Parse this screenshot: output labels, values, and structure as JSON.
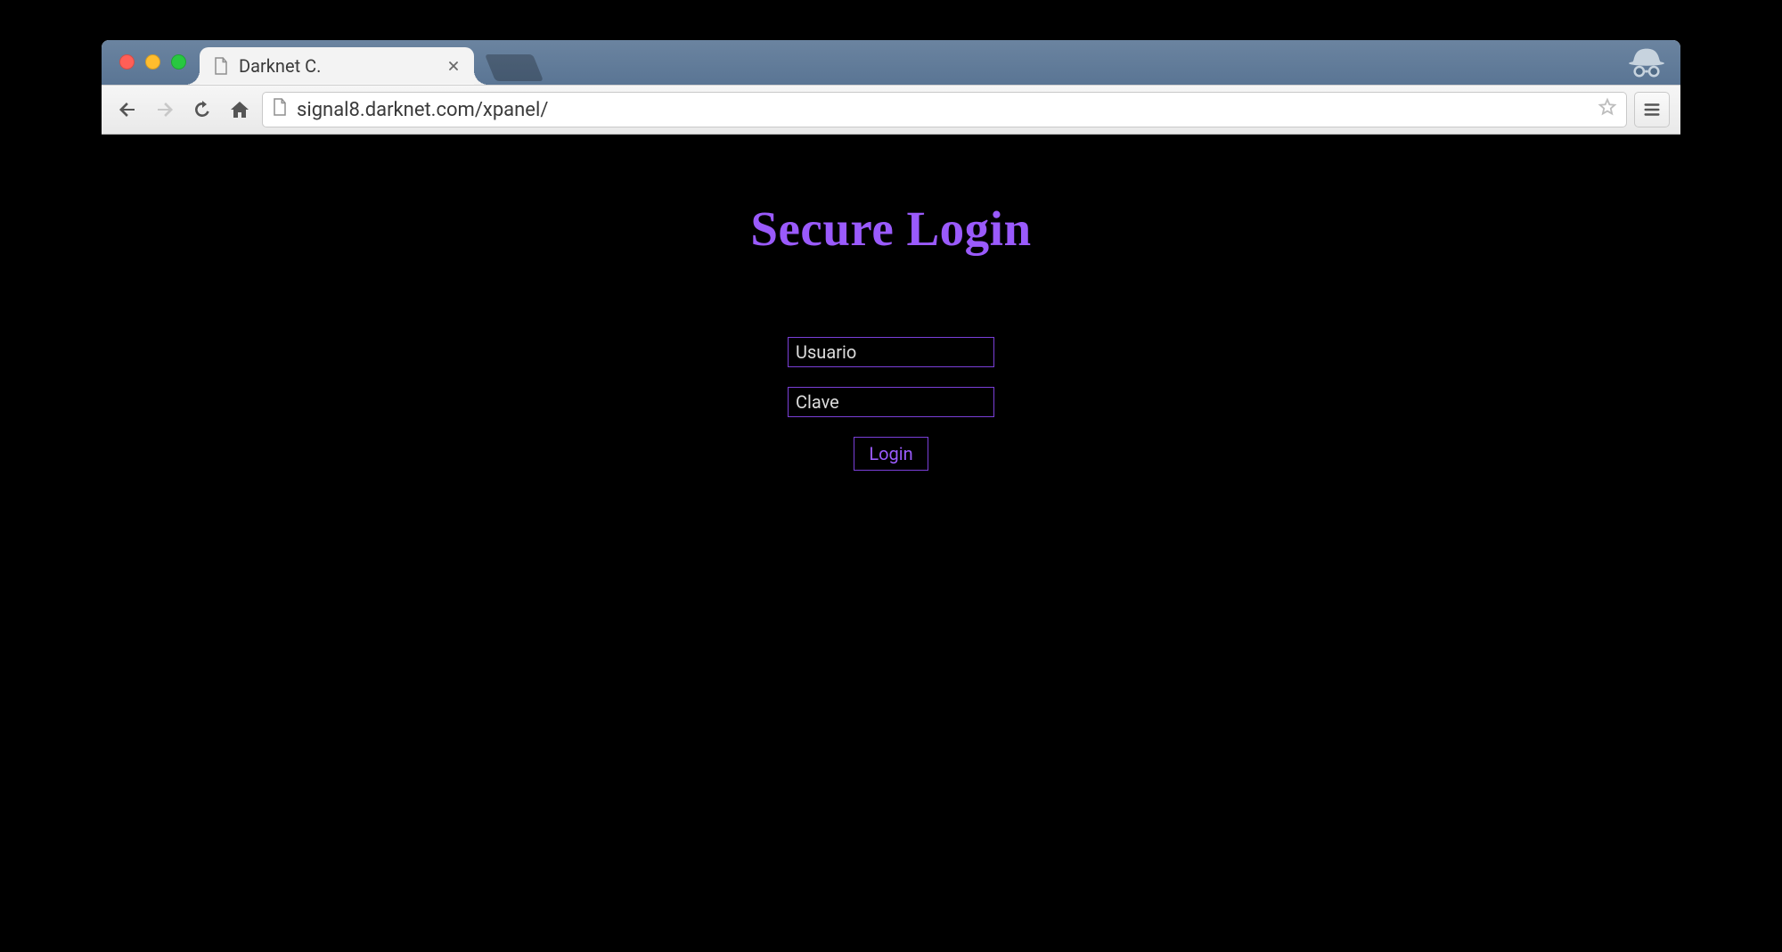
{
  "browser": {
    "tab_title": "Darknet C.",
    "url": "signal8.darknet.com/xpanel/"
  },
  "page": {
    "heading": "Secure Login",
    "username_placeholder": "Usuario",
    "password_placeholder": "Clave",
    "login_button_label": "Login"
  },
  "colors": {
    "accent": "#9a5afc",
    "accent_border": "#7a3fd8",
    "page_bg": "#000000"
  }
}
